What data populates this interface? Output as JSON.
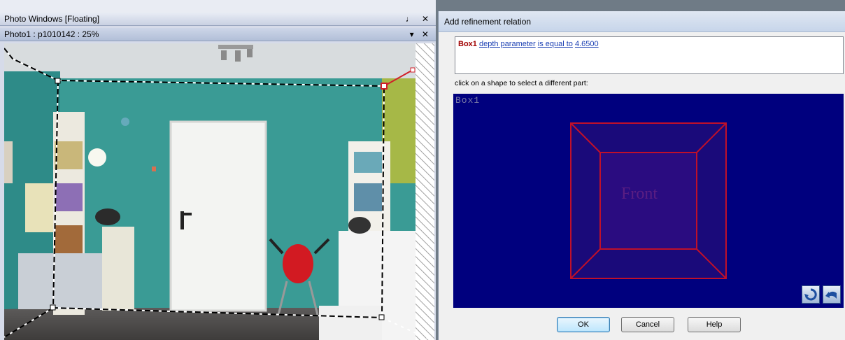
{
  "photo_panel": {
    "title": "Photo Windows [Floating]",
    "title_controls": "♩ ✕",
    "photo_title": "Photo1 : p1010142 : 25%",
    "photo_controls": "▾ ✕"
  },
  "dialog": {
    "title": "Add refinement relation",
    "relation": {
      "part": "Box1",
      "parameter_link": "depth parameter",
      "operator_link": "is equal to",
      "value_link": "4.6500"
    },
    "hint": "click on a shape to select a different part:",
    "canvas": {
      "shape_name": "Box1",
      "face_label": "Front",
      "background_color": "#00007e",
      "edge_color": "#c0102a"
    },
    "buttons": {
      "ok": "OK",
      "cancel": "Cancel",
      "help": "Help"
    },
    "icons": [
      "rotate-icon",
      "undo-icon"
    ]
  }
}
